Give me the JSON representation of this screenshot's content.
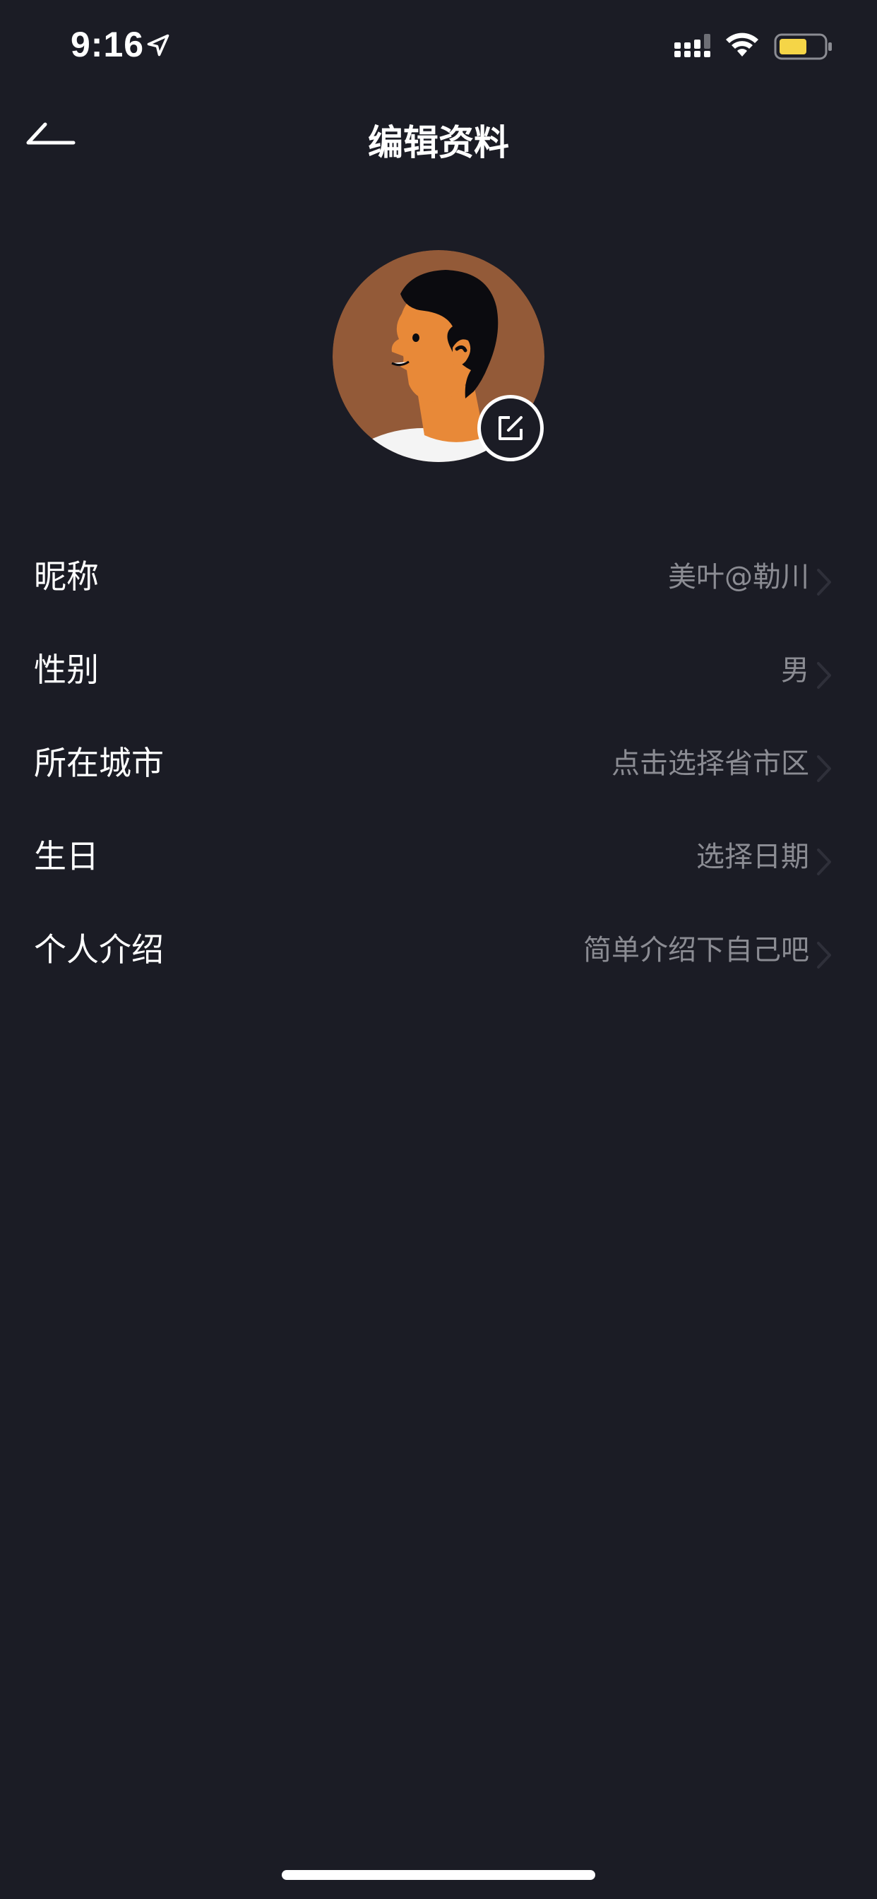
{
  "status_bar": {
    "time": "9:16",
    "location_icon": "location-arrow-icon",
    "signal_icon": "cellular-signal-icon",
    "wifi_icon": "wifi-icon",
    "battery_icon": "battery-icon",
    "battery_color": "#f5d547"
  },
  "nav": {
    "back_icon": "back-arrow-icon",
    "title": "编辑资料"
  },
  "avatar": {
    "edit_icon": "edit-icon"
  },
  "settings": [
    {
      "label": "昵称",
      "value": "美叶@勒川"
    },
    {
      "label": "性别",
      "value": "男"
    },
    {
      "label": "所在城市",
      "value": "点击选择省市区"
    },
    {
      "label": "生日",
      "value": "选择日期"
    },
    {
      "label": "个人介绍",
      "value": "简单介绍下自己吧"
    }
  ],
  "colors": {
    "background": "#1b1c25",
    "primary_text": "#ffffff",
    "secondary_text": "#8b8c93"
  }
}
